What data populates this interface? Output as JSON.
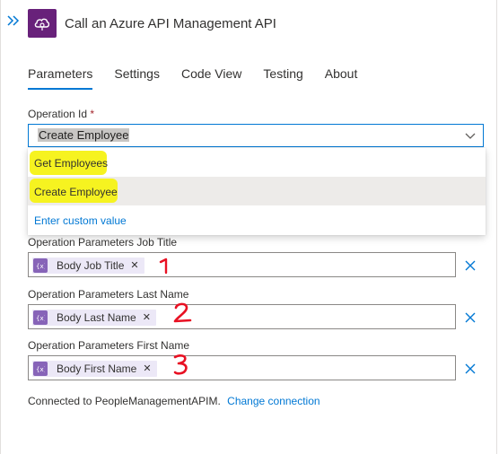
{
  "header": {
    "title": "Call an Azure API Management API",
    "collapse_icon": "double-chevron-right-icon",
    "connector_icon": "api-management-cloud-icon",
    "connector_color": "#68217a"
  },
  "tabs": [
    {
      "label": "Parameters",
      "active": true
    },
    {
      "label": "Settings",
      "active": false
    },
    {
      "label": "Code View",
      "active": false
    },
    {
      "label": "Testing",
      "active": false
    },
    {
      "label": "About",
      "active": false
    }
  ],
  "operation": {
    "label": "Operation Id",
    "required_mark": "*",
    "value": "Create Employee",
    "options": [
      {
        "label": "Get Employees",
        "selected": false
      },
      {
        "label": "Create Employee",
        "selected": true
      },
      {
        "label": "Enter custom value",
        "selected": false
      }
    ]
  },
  "parameters": [
    {
      "label": "Operation Parameters Job Title",
      "token": "Body Job Title",
      "annotation": "1"
    },
    {
      "label": "Operation Parameters Last Name",
      "token": "Body Last Name",
      "annotation": "2"
    },
    {
      "label": "Operation Parameters First Name",
      "token": "Body First Name",
      "annotation": "3"
    }
  ],
  "footer": {
    "text": "Connected to PeopleManagementAPIM.",
    "link": "Change connection"
  },
  "colors": {
    "accent": "#0078d4",
    "highlight": "#f6f320",
    "annotation": "#e81123",
    "token_bg": "#ece8f7",
    "token_icon": "#8764b8"
  }
}
